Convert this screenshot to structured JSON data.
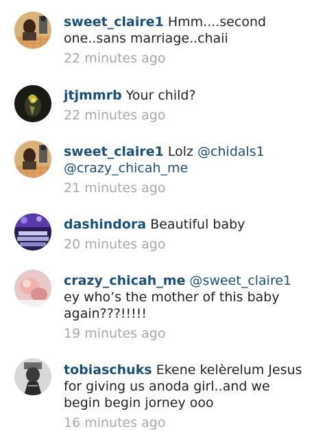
{
  "comments": [
    {
      "username": "sweet_claire1",
      "line1": "Hmm....second",
      "line2": "one..sans marriage..chaii",
      "time": "22 minutes ago",
      "avatar": "sweet-claire1-avatar"
    },
    {
      "username": "jtjmmrb",
      "line1": "Your child?",
      "time": "22 minutes ago",
      "avatar": "jtjmmrb-avatar"
    },
    {
      "username": "sweet_claire1",
      "line1": "Lolz",
      "mention1": "@chidals1",
      "mention2": "@crazy_chicah_me",
      "time": "21 minutes ago",
      "avatar": "sweet-claire1-avatar"
    },
    {
      "username": "dashindora",
      "line1": "Beautiful baby",
      "time": "20 minutes ago",
      "avatar": "dashindora-avatar"
    },
    {
      "username": "crazy_chicah_me",
      "mention1": "@sweet_claire1",
      "line2": "ey who’s the mother of this baby",
      "line3": "again???!!!!!",
      "time": "19 minutes ago",
      "avatar": "crazy-chicah-me-avatar"
    },
    {
      "username": "tobiaschuks",
      "line1": "Ekene kelèrelum Jesus",
      "line2": "for giving us anoda girl..and we",
      "line3": "begin begin jorney ooo",
      "time": "16 minutes ago",
      "avatar": "tobiaschuks-avatar"
    }
  ],
  "colors": {
    "username": "#1a4f7a",
    "text": "#222222",
    "timestamp": "#a8a8a8"
  }
}
